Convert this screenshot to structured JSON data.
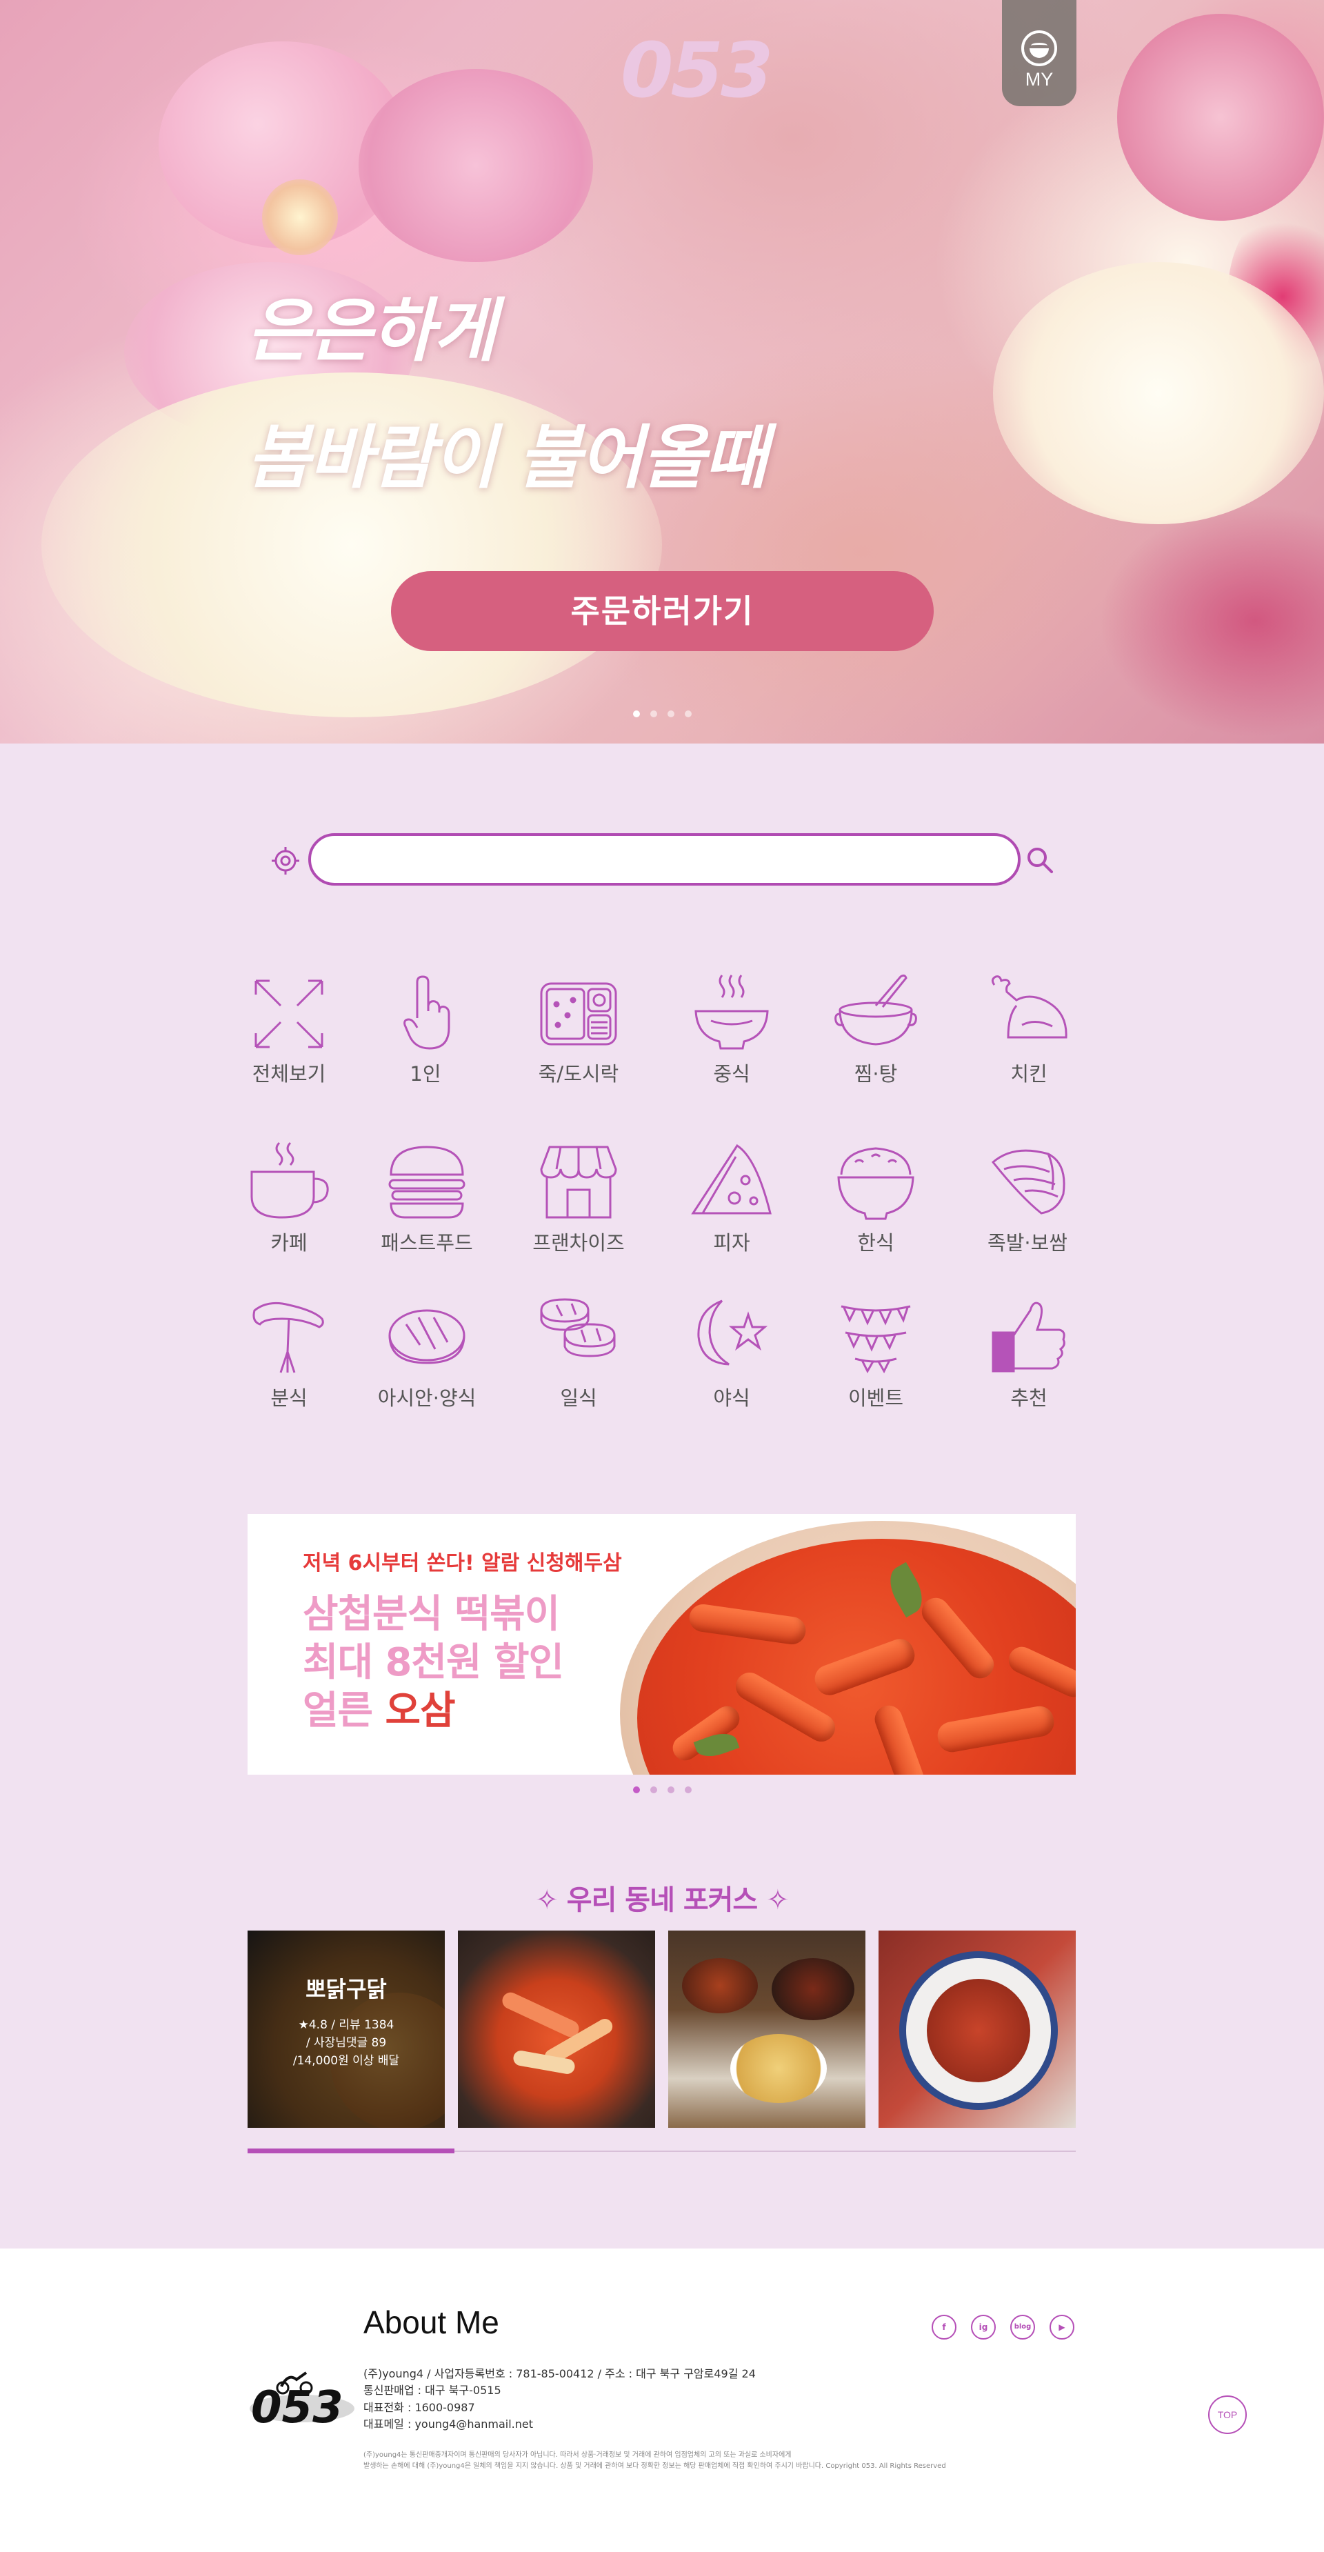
{
  "header": {
    "logo_text": "053",
    "my_label": "MY"
  },
  "hero": {
    "line1": "은은하게",
    "line2": "봄바람이 불어올때",
    "order_button": "주문하러가기",
    "slides": 4,
    "active_slide": 1
  },
  "search": {
    "value": "",
    "placeholder": ""
  },
  "categories": [
    {
      "label": "전체보기",
      "icon": "expand-icon"
    },
    {
      "label": "1인",
      "icon": "finger-icon"
    },
    {
      "label": "죽/도시락",
      "icon": "lunchbox-icon"
    },
    {
      "label": "중식",
      "icon": "noodle-bowl-icon"
    },
    {
      "label": "찜·탕",
      "icon": "pot-icon"
    },
    {
      "label": "치킨",
      "icon": "chicken-icon"
    },
    {
      "label": "카페",
      "icon": "coffee-cup-icon"
    },
    {
      "label": "패스트푸드",
      "icon": "burger-icon"
    },
    {
      "label": "프랜차이즈",
      "icon": "store-icon"
    },
    {
      "label": "피자",
      "icon": "pizza-icon"
    },
    {
      "label": "한식",
      "icon": "rice-bowl-icon"
    },
    {
      "label": "족발·보쌈",
      "icon": "pork-icon"
    },
    {
      "label": "분식",
      "icon": "sausage-icon"
    },
    {
      "label": "아시안·양식",
      "icon": "steak-icon"
    },
    {
      "label": "일식",
      "icon": "sushi-icon"
    },
    {
      "label": "야식",
      "icon": "moon-star-icon"
    },
    {
      "label": "이벤트",
      "icon": "bunting-icon"
    },
    {
      "label": "추천",
      "icon": "thumbs-up-icon"
    }
  ],
  "banner": {
    "tagline": "저녁 6시부터 쏜다! 알람 신청해두삼",
    "headline1": "삼첩분식 떡볶이",
    "headline2": "최대 8천원 할인",
    "headline3_prefix": "얼른 ",
    "headline3_accent": "오삼",
    "slides": 4,
    "active_slide": 1
  },
  "focus": {
    "title": "우리 동네 포커스",
    "title_deco": "✧",
    "cards": [
      {
        "name": "뽀닭구닭",
        "rating_line": "★4.8 / 리뷰 1384",
        "reply_line": "/ 사장님댓글 89",
        "min_order_line": "/14,000원 이상 배달",
        "image": "fried-chicken"
      },
      {
        "image": "tteokbokki-pan"
      },
      {
        "image": "chinese-set"
      },
      {
        "image": "spicy-octopus"
      }
    ],
    "progress": 0.25
  },
  "footer": {
    "title": "About Me",
    "company_line": "(주)young4 / 사업자등록번호 : 781-85-00412 / 주소 : 대구 북구 구암로49길 24",
    "telecom_line": "통신판매업 : 대구 북구-0515",
    "phone_line": "대표전화 : 1600-0987",
    "email_line": "대표메일 : young4@hanmail.net",
    "notice_line1": "(주)young4는 통신판매중개자이며 통신판매의 당사자가 아닙니다. 따라서 상품·거래정보 및 거래에 관하여 입점업체의 고의 또는 과실로 소비자에게",
    "notice_line2": "발생하는 손해에 대해 (주)young4은 일체의 책임을 지지 않습니다. 상품 및 거래에 관하여 보다 정확한 정보는 해당 판매업체에 직접 확인하여 주시기 바랍니다. Copyright 053. All Rights Reserved",
    "social": [
      "f",
      "ig",
      "blog",
      "▶"
    ],
    "top_label": "TOP"
  },
  "colors": {
    "accent": "#b54fb7",
    "order_button": "#d6607f",
    "page_bg": "#f1e2f1",
    "banner_red": "#e63a3a",
    "banner_pink": "#ee9bc6"
  }
}
